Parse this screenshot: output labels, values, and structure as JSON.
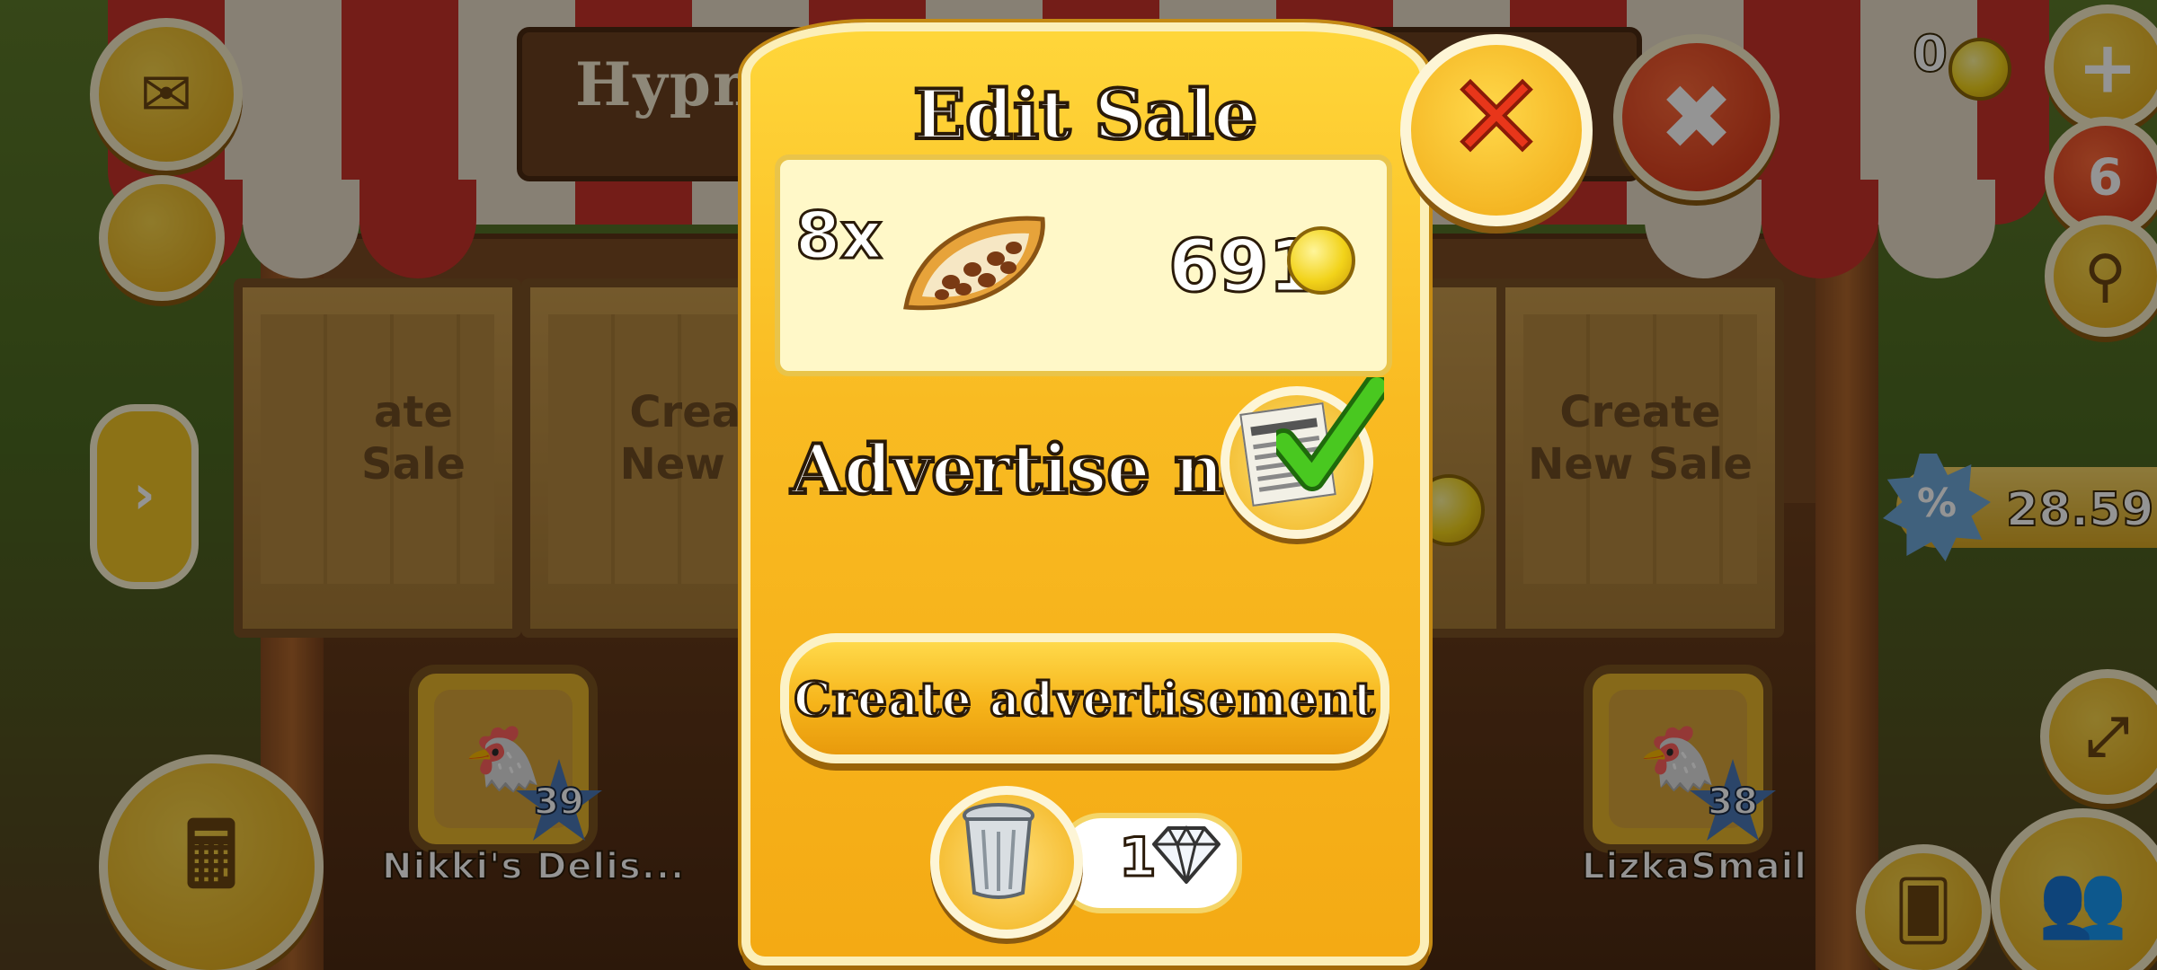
{
  "background": {
    "stall_title": "Hypnot",
    "crate_left_text": "ate\nSale",
    "crate_mid_text": "Create\nNew Sa",
    "crate_right_text": "Create\nNew Sale",
    "shop_left": {
      "name": "Nikki's Delis...",
      "level": "39"
    },
    "shop_right": {
      "name": "LizkaSmail",
      "level": "38"
    },
    "timer": "28.59",
    "hud_count": "6",
    "hud_coins_partial": "0"
  },
  "dialog": {
    "title": "Edit Sale",
    "item": {
      "quantity": "8x",
      "icon": "cocoa-pod-icon",
      "price": "691"
    },
    "advertise_label": "Advertise now",
    "advertise_checked": true,
    "create_ad_label": "Create advertisement",
    "delete_cost": "1"
  },
  "colors": {
    "dialog_yellow": "#f9bb22",
    "close_red": "#e8361a",
    "check_green": "#3fbf1e"
  }
}
